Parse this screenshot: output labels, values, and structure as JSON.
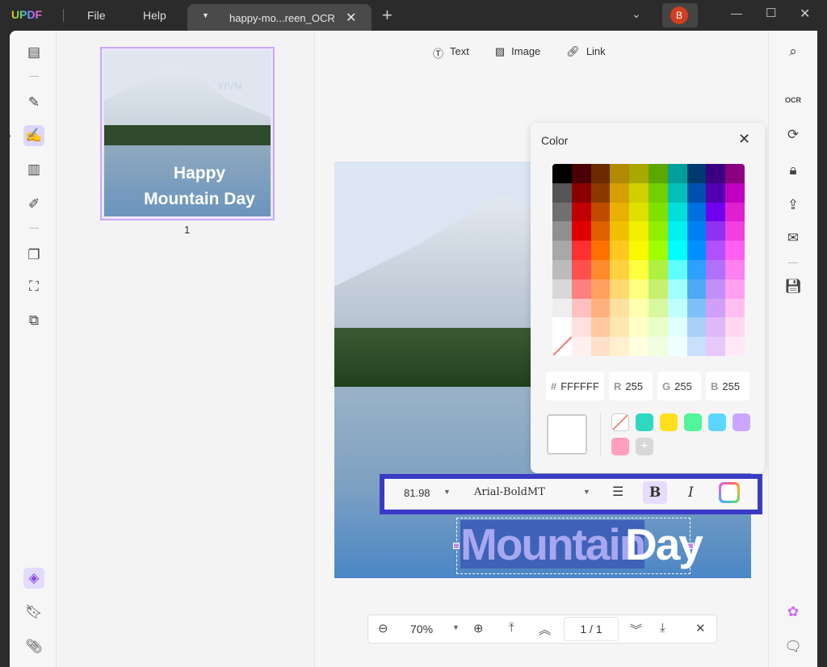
{
  "app": {
    "logo": "UPDF",
    "menu": [
      "File",
      "Help"
    ],
    "tab_title": "happy-mo...reen_OCR",
    "avatar": "B"
  },
  "toolbar_top": {
    "items": [
      {
        "label": "Text",
        "icon": "text-box-icon"
      },
      {
        "label": "Image",
        "icon": "image-icon"
      },
      {
        "label": "Link",
        "icon": "link-icon"
      }
    ]
  },
  "thumbnail": {
    "line1": "Happy",
    "line2": "Mountain Day",
    "page": "1",
    "watermark": "YIVN"
  },
  "canvas": {
    "selected_text": "Mountain",
    "other_text": "Day"
  },
  "color_popup": {
    "title": "Color",
    "hex_label": "#",
    "hex": "FFFFFF",
    "r_label": "R",
    "r": "255",
    "g_label": "G",
    "g": "255",
    "b_label": "B",
    "b": "255",
    "current_color": "#FFFFFF",
    "palette": [
      [
        "#000000",
        "#4a0000",
        "#6b2a00",
        "#b08a00",
        "#a8a800",
        "#5aa800",
        "#00a09a",
        "#003a70",
        "#3a0080",
        "#8a0080"
      ],
      [
        "#555555",
        "#8a0000",
        "#8a3a00",
        "#d4a000",
        "#d0d000",
        "#70d000",
        "#00c0b8",
        "#0050b0",
        "#5000b0",
        "#c000c0"
      ],
      [
        "#707070",
        "#c00000",
        "#c04a00",
        "#e8b000",
        "#e0e000",
        "#80e000",
        "#00e0d8",
        "#0070e0",
        "#7000f0",
        "#e020d0"
      ],
      [
        "#909090",
        "#e00000",
        "#e06000",
        "#f0c000",
        "#f0f000",
        "#90f000",
        "#00f0f0",
        "#0080f0",
        "#9030f0",
        "#f040e0"
      ],
      [
        "#a8a8a8",
        "#ff3030",
        "#ff7000",
        "#ffc820",
        "#f8f800",
        "#a0ff00",
        "#00ffff",
        "#0090ff",
        "#b050ff",
        "#ff60f0"
      ],
      [
        "#bbbbbb",
        "#ff5050",
        "#ff8a30",
        "#ffd040",
        "#ffff40",
        "#b0f040",
        "#60ffff",
        "#30a0ff",
        "#b070f8",
        "#ff80f0"
      ],
      [
        "#d8d8d8",
        "#ff8080",
        "#ffa060",
        "#ffd870",
        "#ffff80",
        "#c8f070",
        "#a0ffff",
        "#50a8f8",
        "#c090f8",
        "#ffa0f0"
      ],
      [
        "#eeeeee",
        "#ffc0c0",
        "#ffb080",
        "#ffe0a0",
        "#ffffb0",
        "#d8f8a0",
        "#c0ffff",
        "#80c0f8",
        "#d0a0f8",
        "#ffc0f0"
      ],
      [
        "#ffffff",
        "#ffe0e0",
        "#ffc8a0",
        "#ffe8b0",
        "#ffffc8",
        "#e8ffc8",
        "#e0ffff",
        "#a8d0f8",
        "#e0b8f8",
        "#ffd8f0"
      ],
      [
        "none",
        "#fff0f0",
        "#ffe0c8",
        "#fff0d0",
        "#ffffe0",
        "#f0ffe0",
        "#f0ffff",
        "#c8e0fb",
        "#e8c8fb",
        "#ffe8f8"
      ]
    ],
    "recent": [
      "none",
      "#2ed8c3",
      "#ffe01a",
      "#52f59a",
      "#5ad6ff",
      "#c9a6ff",
      "#ff9fbf"
    ]
  },
  "text_toolbar": {
    "font_size": "81.98",
    "font_name": "Arial-BoldMT",
    "bold": "B",
    "italic": "I"
  },
  "navbar": {
    "zoom": "70%",
    "page_current": "1",
    "page_sep": "/",
    "page_total": "1"
  },
  "accent": "#3a3ac6"
}
